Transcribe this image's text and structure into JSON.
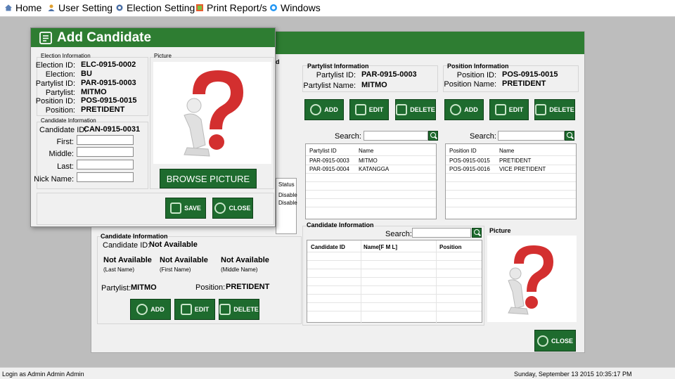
{
  "menubar": {
    "items": [
      {
        "label": "Home",
        "icon": "home-icon"
      },
      {
        "label": "User Setting",
        "icon": "user-icon"
      },
      {
        "label": "Election Setting",
        "icon": "election-icon"
      },
      {
        "label": "Print Report/s",
        "icon": "print-icon"
      },
      {
        "label": "Windows",
        "icon": "windows-icon"
      }
    ]
  },
  "statusbar": {
    "login": "Login as Admin Admin Admin",
    "datetime": "Sunday, September 13 2015 10:35:17 PM"
  },
  "bigwin": {
    "partial_title": "d",
    "partylist_info": {
      "title": "Partylist Information",
      "id_label": "Partylist ID:",
      "id_value": "PAR-0915-0003",
      "name_label": "Partylist Name:",
      "name_value": "MITMO"
    },
    "position_info": {
      "title": "Position Information",
      "id_label": "Position ID:",
      "id_value": "POS-0915-0015",
      "name_label": "Position Name:",
      "name_value": "PRETIDENT"
    },
    "buttons": {
      "add": "ADD",
      "edit": "EDIT",
      "delete": "DELETE",
      "close": "CLOSE"
    },
    "search_label": "Search:",
    "partylist_table": {
      "headers": [
        "Partylist ID",
        "Name"
      ],
      "rows": [
        [
          "PAR-0915-0003",
          "MITMO"
        ],
        [
          "PAR-0915-0004",
          "KATANGGA"
        ]
      ]
    },
    "position_table": {
      "headers": [
        "Position ID",
        "Name"
      ],
      "rows": [
        [
          "POS-0915-0015",
          "PRETIDENT"
        ],
        [
          "POS-0915-0016",
          "VICE PRETIDENT"
        ]
      ]
    },
    "left_list": {
      "status_header": "Status",
      "rows": [
        "Disable",
        "Disable"
      ]
    },
    "candidate_info_left": {
      "title": "Candidate Information",
      "id_label": "Candidate ID:",
      "id_value": "Not Available",
      "last_value": "Not Available",
      "last_caption": "(Last Name)",
      "first_value": "Not Available",
      "first_caption": "(First Name)",
      "middle_value": "Not Available",
      "middle_caption": "(Middle Name)",
      "partylist_label": "Partylist:",
      "partylist_value": "MITMO",
      "position_label": "Position:",
      "position_value": "PRETIDENT"
    },
    "candidate_info_right": {
      "title": "Candidate Information",
      "headers": [
        "Candidate ID",
        "Name[F M L]",
        "Position"
      ]
    },
    "picture_title": "Picture"
  },
  "dialog": {
    "title": "Add Candidate",
    "election_info": {
      "title": "Election Information",
      "fields": [
        {
          "label": "Election ID:",
          "value": "ELC-0915-0002"
        },
        {
          "label": "Election:",
          "value": "BU"
        },
        {
          "label": "Partylist ID:",
          "value": "PAR-0915-0003"
        },
        {
          "label": "Partylist:",
          "value": "MITMO"
        },
        {
          "label": "Position ID:",
          "value": "POS-0915-0015"
        },
        {
          "label": "Position:",
          "value": "PRETIDENT"
        }
      ]
    },
    "candidate_info": {
      "title": "Candidate Information",
      "id_label": "Candidate ID:",
      "id_value": "CAN-0915-0031",
      "first_label": "First:",
      "middle_label": "Middle:",
      "last_label": "Last:",
      "nick_label": "Nick Name:",
      "first_value": "",
      "middle_value": "",
      "last_value": "",
      "nick_value": ""
    },
    "picture_title": "Picture",
    "browse_label": "BROWSE PICTURE",
    "save_label": "SAVE",
    "close_label": "CLOSE"
  },
  "colors": {
    "accent": "#2e7d32",
    "button": "#1e6b2e",
    "question_red": "#d32f2f"
  }
}
